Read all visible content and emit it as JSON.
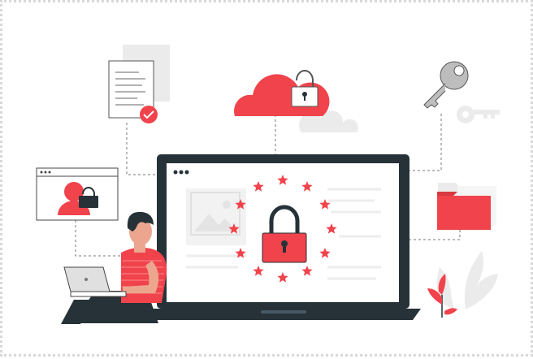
{
  "illustration": {
    "subject": "data-security",
    "icons": [
      "document-check-icon",
      "cloud-lock-icon",
      "key-icon",
      "user-lock-window-icon",
      "laptop-padlock-icon",
      "folder-icon",
      "person-laptop-figure",
      "plant-icon"
    ],
    "colors": {
      "accent": "#f0434b",
      "dark": "#263238",
      "gray_light": "#ebebeb",
      "gray_mid": "#cfcfcf",
      "gray_stroke": "#9e9e9e",
      "skin": "#eca68f",
      "white": "#ffffff"
    },
    "stars": 12
  }
}
